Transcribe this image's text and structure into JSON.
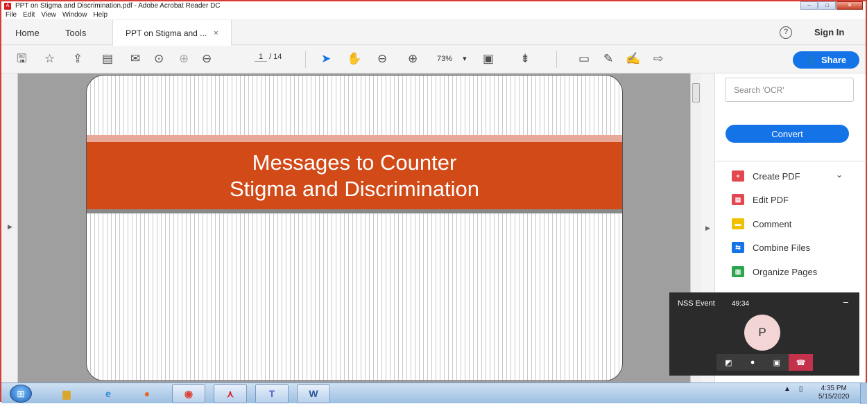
{
  "window": {
    "title": "PPT on Stigma and Discrimination.pdf - Adobe Acrobat Reader DC",
    "controls": {
      "minimize": "–",
      "maximize": "□",
      "close": "✕"
    }
  },
  "menu": [
    "File",
    "Edit",
    "View",
    "Window",
    "Help"
  ],
  "tabs": {
    "home": "Home",
    "tools": "Tools",
    "document": "PPT on Stigma and ...",
    "close": "×",
    "help": "?",
    "sign_in": "Sign In"
  },
  "toolbar": {
    "page_current": "1",
    "page_total": "/ 14",
    "zoom": "73%",
    "zoom_caret": "▾",
    "share": "Share"
  },
  "slide": {
    "title_line1": "Messages to Counter",
    "title_line2": "Stigma and Discrimination"
  },
  "right_panel": {
    "search_placeholder": "Search 'OCR'",
    "convert": "Convert",
    "tools": [
      {
        "label": "Create PDF",
        "color": "#e34850"
      },
      {
        "label": "Edit PDF",
        "color": "#e34850"
      },
      {
        "label": "Comment",
        "color": "#f0c000"
      },
      {
        "label": "Combine Files",
        "color": "#1473e6"
      },
      {
        "label": "Organize Pages",
        "color": "#2da44e"
      }
    ]
  },
  "teams_call": {
    "title": "NSS Event",
    "duration": "49:34",
    "avatar_initial": "P",
    "minimize": "–"
  },
  "taskbar": {
    "time": "4:35 PM",
    "date": "5/15/2020",
    "tray_arrow": "▲"
  },
  "colors": {
    "accent_blue": "#1473e6",
    "slide_band": "#d14a18",
    "hangup": "#c4314b"
  }
}
